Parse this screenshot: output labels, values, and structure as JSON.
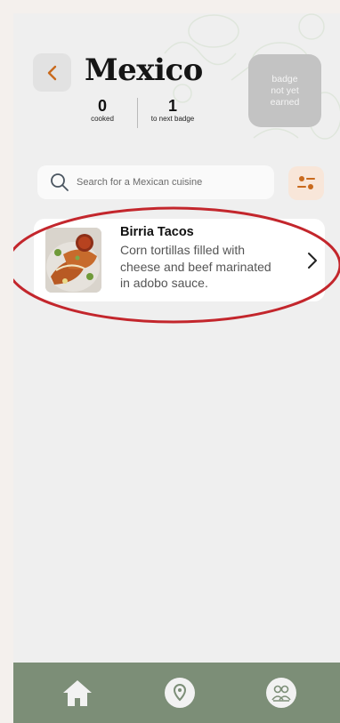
{
  "header": {
    "title": "Mexico",
    "back_icon": "chevron-left-icon",
    "stats": [
      {
        "value": "0",
        "label": "cooked"
      },
      {
        "value": "1",
        "label": "to next badge"
      }
    ],
    "badge_lines": [
      "badge",
      "not yet",
      "earned"
    ]
  },
  "search": {
    "placeholder": "Search for a Mexican cuisine",
    "icon": "search-icon",
    "filter_icon": "filter-icon"
  },
  "dishes": [
    {
      "name": "Birria Tacos",
      "description": "Corn tortillas filled with cheese and beef marinated in adobo sauce.",
      "image": "birria-tacos-photo",
      "action_icon": "chevron-right-icon"
    }
  ],
  "tabbar": {
    "items": [
      {
        "name": "home",
        "icon": "home-icon"
      },
      {
        "name": "map",
        "icon": "map-pin-icon"
      },
      {
        "name": "community",
        "icon": "people-icon"
      }
    ]
  },
  "colors": {
    "accent": "#c96a1d",
    "tabbar": "#7c8e77",
    "highlight": "#c3262c",
    "badge": "#c3c3c3"
  }
}
